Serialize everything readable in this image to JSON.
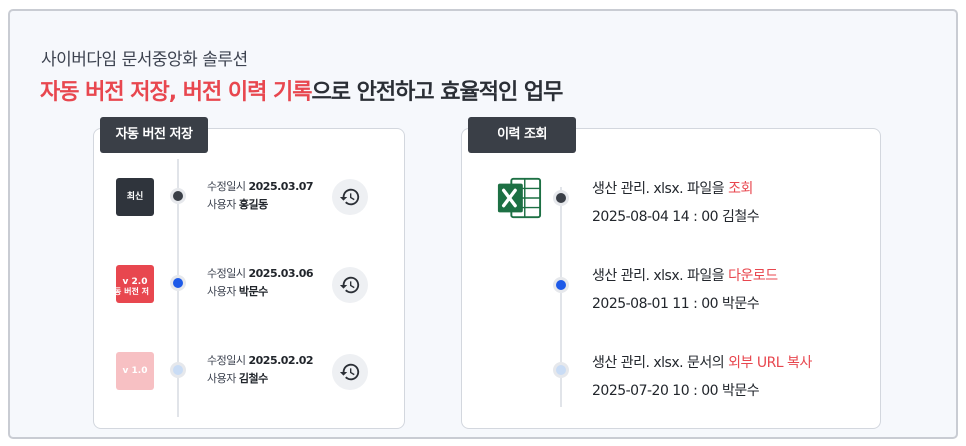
{
  "header": {
    "subtitle": "사이버다임 문서중앙화 솔루션",
    "headline_accent": "자동 버전 저장, 버전 이력  기록",
    "headline_rest": "으로  안전하고 효율적인 업무"
  },
  "versions_panel": {
    "tab_label": "자동 버전 저장",
    "modified_label": "수정일시",
    "user_label": "사용자",
    "items": [
      {
        "badge": "최신",
        "date": "2025.03.07",
        "user": "홍길동",
        "dot": "dark"
      },
      {
        "badge": "v 2.0",
        "badge_ghost": "동 버전 저",
        "date": "2025.03.06",
        "user": "박문수",
        "dot": "blue"
      },
      {
        "badge": "v 1.0",
        "date": "2025.02.02",
        "user": "김철수",
        "dot": "light"
      }
    ],
    "restore_icon": "history-icon"
  },
  "history_panel": {
    "tab_label": "이력 조회",
    "file_icon": "excel-icon",
    "entries": [
      {
        "prefix": "생산 관리. xlsx. 파일을 ",
        "action": "조회",
        "stamp": "2025-08-04 14 : 00 김철수"
      },
      {
        "prefix": "생산 관리. xlsx. 파일을 ",
        "action": "다운로드",
        "stamp": "2025-08-01 11 : 00 박문수"
      },
      {
        "prefix": "생산 관리. xlsx. 문서의 ",
        "action": "외부 URL 복사",
        "stamp": "2025-07-20 10 : 00 박문수"
      }
    ]
  },
  "colors": {
    "accent": "#e8474f",
    "dark": "#3a3f47",
    "blue": "#1e5ae8",
    "light_blue": "#c9dcf5",
    "excel_green": "#1d7044"
  }
}
